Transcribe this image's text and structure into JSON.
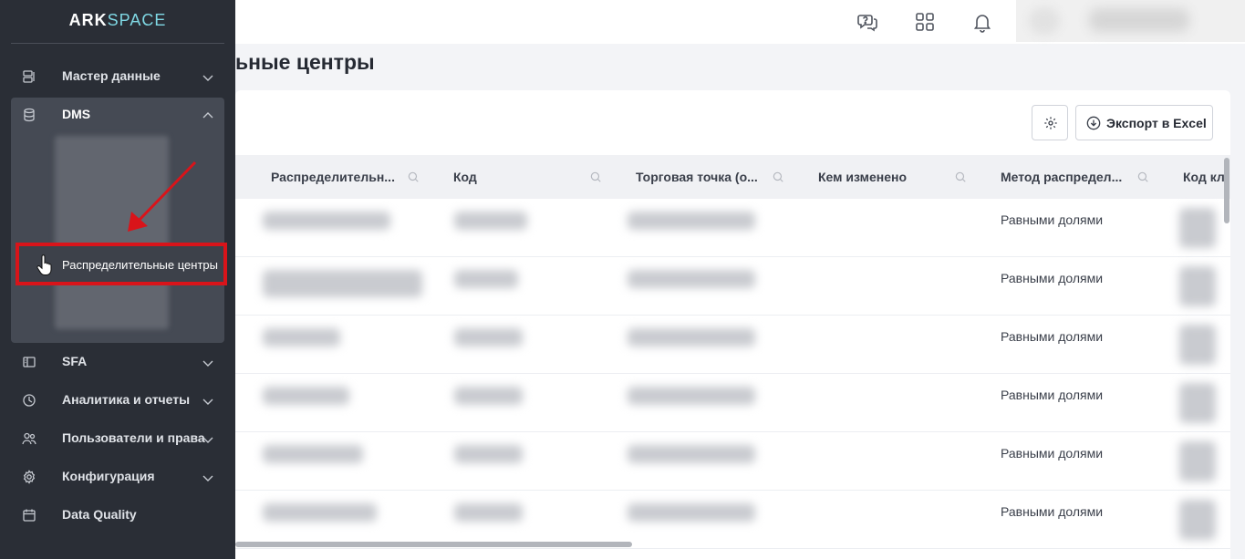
{
  "brand": {
    "logo_left": "ARK",
    "logo_right": "SPACE"
  },
  "sidebar": {
    "items": [
      {
        "label": "Мастер данные",
        "icon": "master-data-icon",
        "expanded": false
      },
      {
        "label": "DMS",
        "icon": "database-icon",
        "expanded": true
      },
      {
        "label": "SFA",
        "icon": "sfa-icon",
        "expanded": false
      },
      {
        "label": "Аналитика и отчеты",
        "icon": "analytics-icon",
        "expanded": false
      },
      {
        "label": "Пользователи и права",
        "icon": "users-icon",
        "expanded": false
      },
      {
        "label": "Конфигурация",
        "icon": "gear-icon",
        "expanded": false
      },
      {
        "label": "Data Quality",
        "icon": "calendar-icon",
        "expanded": false
      }
    ],
    "dms_active_subitem": "Распределительные центры"
  },
  "header": {
    "icons": [
      "help-chat-icon",
      "apps-grid-icon",
      "bell-icon"
    ]
  },
  "page": {
    "title_visible": "ьные центры"
  },
  "toolbar": {
    "export_label": "Экспорт в Excel"
  },
  "table": {
    "columns": [
      "Распределительн...",
      "Код",
      "Торговая точка (о...",
      "Кем изменено",
      "Метод распредел...",
      "Код кл"
    ],
    "rows": [
      {
        "method": "Равными долями"
      },
      {
        "method": "Равными долями"
      },
      {
        "method": "Равными долями"
      },
      {
        "method": "Равными долями"
      },
      {
        "method": "Равными долями"
      },
      {
        "method": "Равными долями"
      }
    ]
  },
  "colors": {
    "sidebar_bg": "#2a2e36",
    "highlight_border": "#d9141a",
    "annotation_arrow": "#d9141a",
    "logo_accent": "#7fd8e4"
  }
}
